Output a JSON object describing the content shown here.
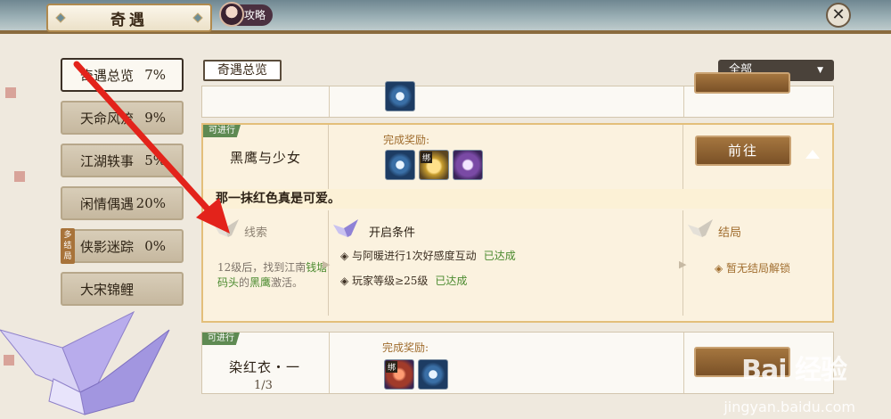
{
  "header": {
    "title": "奇遇",
    "guide_label": "攻略"
  },
  "sidebar": {
    "items": [
      {
        "label": "奇遇总览",
        "pct": "7%"
      },
      {
        "label": "天命风流",
        "pct": "9%"
      },
      {
        "label": "江湖轶事",
        "pct": "5%"
      },
      {
        "label": "闲情偶遇",
        "pct": "20%"
      },
      {
        "label": "侠影迷踪",
        "pct": "0%"
      },
      {
        "label": "大宋锦鲤",
        "pct": ""
      }
    ],
    "multi_ending_badge": "多结局"
  },
  "main": {
    "overview_tab": "奇遇总览",
    "filter_value": "全部",
    "active_quest": {
      "status": "可进行",
      "name": "黑鹰与少女",
      "reward_label": "完成奖励:",
      "bind_mark": "绑",
      "go_label": "前往",
      "description": "那一抹红色真是可爱。",
      "clue_head": "线索",
      "clue_text_1": "12级后，找到江南",
      "clue_text_hl1": "钱塘码头",
      "clue_text_2": "的",
      "clue_text_hl2": "黑鹰",
      "clue_text_3": "激活。",
      "condition_head": "开启条件",
      "conditions": [
        {
          "text": "◈ 与阿暖进行1次好感度互动",
          "state": "已达成"
        },
        {
          "text": "◈ 玩家等级≥25级",
          "state": "已达成"
        }
      ],
      "ending_head": "结局",
      "ending_text": "◈ 暂无结局解锁"
    },
    "next_quest": {
      "status": "可进行",
      "name": "染红衣・一",
      "progress": "1/3",
      "reward_label": "完成奖励:",
      "bind_mark": "绑"
    }
  },
  "watermark": {
    "brand": "Bai 经验",
    "url": "jingyan.baidu.com"
  }
}
